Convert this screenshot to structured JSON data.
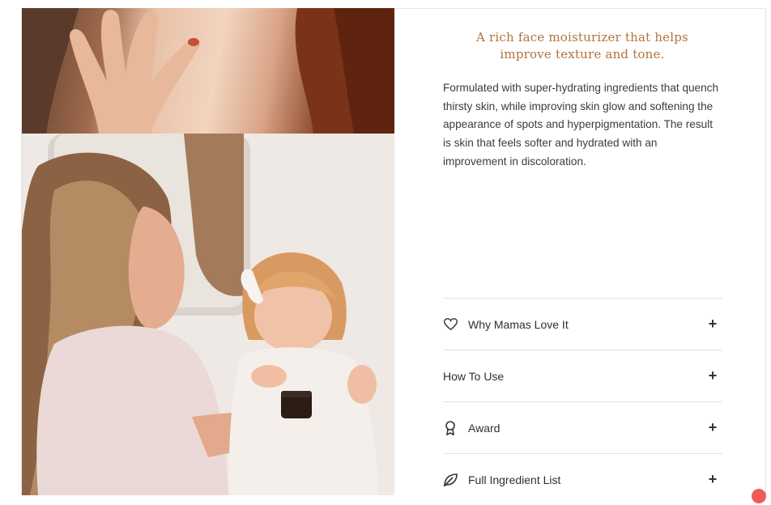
{
  "headline": "A rich face moisturizer that helps improve texture and tone.",
  "description": "Formulated with super-hydrating ingredients that quench thirsty skin, while improving skin glow and softening the appearance of spots and hyperpigmentation. The result is skin that feels softer and hydrated with an improvement in discoloration.",
  "accordion": [
    {
      "label": "Why Mamas Love It",
      "icon": "heart-icon"
    },
    {
      "label": "How To Use",
      "icon": ""
    },
    {
      "label": "Award",
      "icon": "award-icon"
    },
    {
      "label": "Full Ingredient List",
      "icon": "leaf-icon"
    }
  ],
  "expand_symbol": "+",
  "colors": {
    "headline": "#b0733d",
    "text": "#3c3c3c",
    "divider": "#e4e1dd"
  }
}
